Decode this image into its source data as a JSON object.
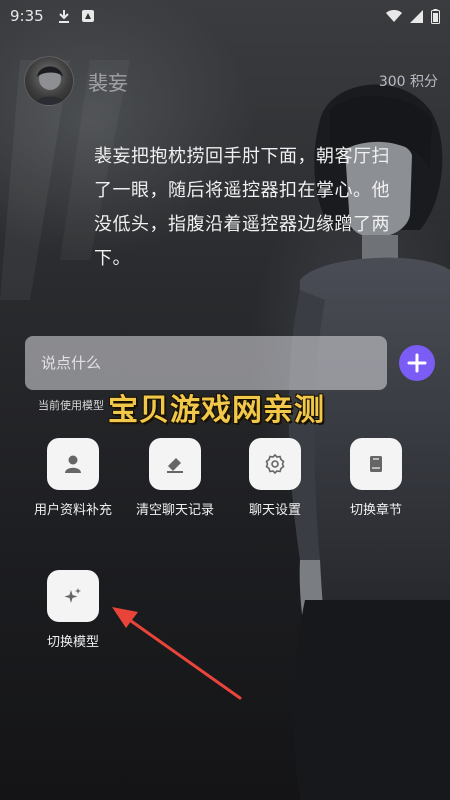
{
  "status_bar": {
    "time": "9:35",
    "left_icons": [
      "download-icon",
      "app-icon"
    ],
    "right_icons": [
      "wifi-icon",
      "signal-icon",
      "battery-icon"
    ]
  },
  "header": {
    "character_name": "裴妄",
    "points": "300 积分"
  },
  "narration": "裴妄把抱枕捞回手肘下面，朝客厅扫了一眼，随后将遥控器扣在掌心。他没低头，指腹沿着遥控器边缘蹭了两下。",
  "chat": {
    "placeholder": "说点什么",
    "model_hint": "当前使用模型"
  },
  "watermark": "宝贝游戏网亲测",
  "actions": [
    {
      "label": "用户资料补充",
      "icon": "user-icon"
    },
    {
      "label": "清空聊天记录",
      "icon": "eraser-icon"
    },
    {
      "label": "聊天设置",
      "icon": "gear-icon"
    },
    {
      "label": "切换章节",
      "icon": "book-icon"
    },
    {
      "label": "切换模型",
      "icon": "sparkle-icon"
    }
  ],
  "colors": {
    "accent": "#7b5cf5",
    "watermark": "#f2c84b",
    "arrow": "#e8443a"
  }
}
